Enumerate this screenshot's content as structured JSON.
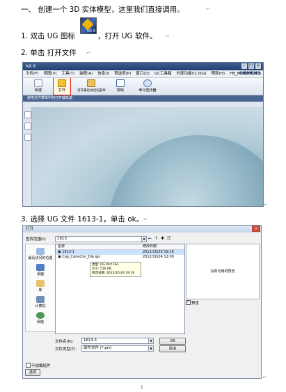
{
  "heading": "一、 创建一个 3D 实体模型，这里我们直接调用。",
  "step1": {
    "before": "1. 双击 UG 图标",
    "after": "，打开 UG 软件。"
  },
  "ug_icon_caption": "NX 8",
  "step2": "2. 单击 打开文件",
  "step3": "3. 选择 UG 文件 1613-1，单击 ok。",
  "page_number": "1",
  "nx_window": {
    "title": "NX 8",
    "menus": [
      "文件(F)",
      "视图(V)",
      "工具(T)",
      "装配(A)",
      "信息(I)",
      "首选项(P)",
      "窗口(O)",
      "GC工具箱",
      "外部功能V2.0(G)",
      "帮助(H)",
      "HB_MOULD V6.5"
    ],
    "brand": "SIEMENS",
    "toolbar": [
      "新建",
      "打开",
      "打开最近访问的部件",
      "帮助",
      "命令查找器"
    ],
    "resource_bar": "使用文件菜单中的打开或新建"
  },
  "open_dialog": {
    "title": "打开",
    "look_in_label": "查找范围(I):",
    "look_in_value": "1613",
    "places": [
      "最近访问的位置",
      "桌面",
      "库",
      "计算机",
      "网络"
    ],
    "columns": [
      "名称",
      "修改日期"
    ],
    "files": [
      {
        "name": "1613-1",
        "date": "2012/10/29 19:16"
      },
      {
        "name": "Cap_Conector_Die.igs",
        "date": "2012/10/24 12:09"
      }
    ],
    "tooltip": [
      "类型: UG Part File",
      "大小: 516 KB",
      "修改日期: 2012/10/29 19:16"
    ],
    "preview_text": "没有可用的预览",
    "preview_check": "预览",
    "filename_label": "文件名(N):",
    "filename_value": "1613-1",
    "filetype_label": "文件类型(T):",
    "filetype_value": "部件文件 (*.prt)",
    "ok_label": "OK",
    "cancel_label": "取消",
    "no_load_label": "不加载组件",
    "options_label": "选项"
  }
}
